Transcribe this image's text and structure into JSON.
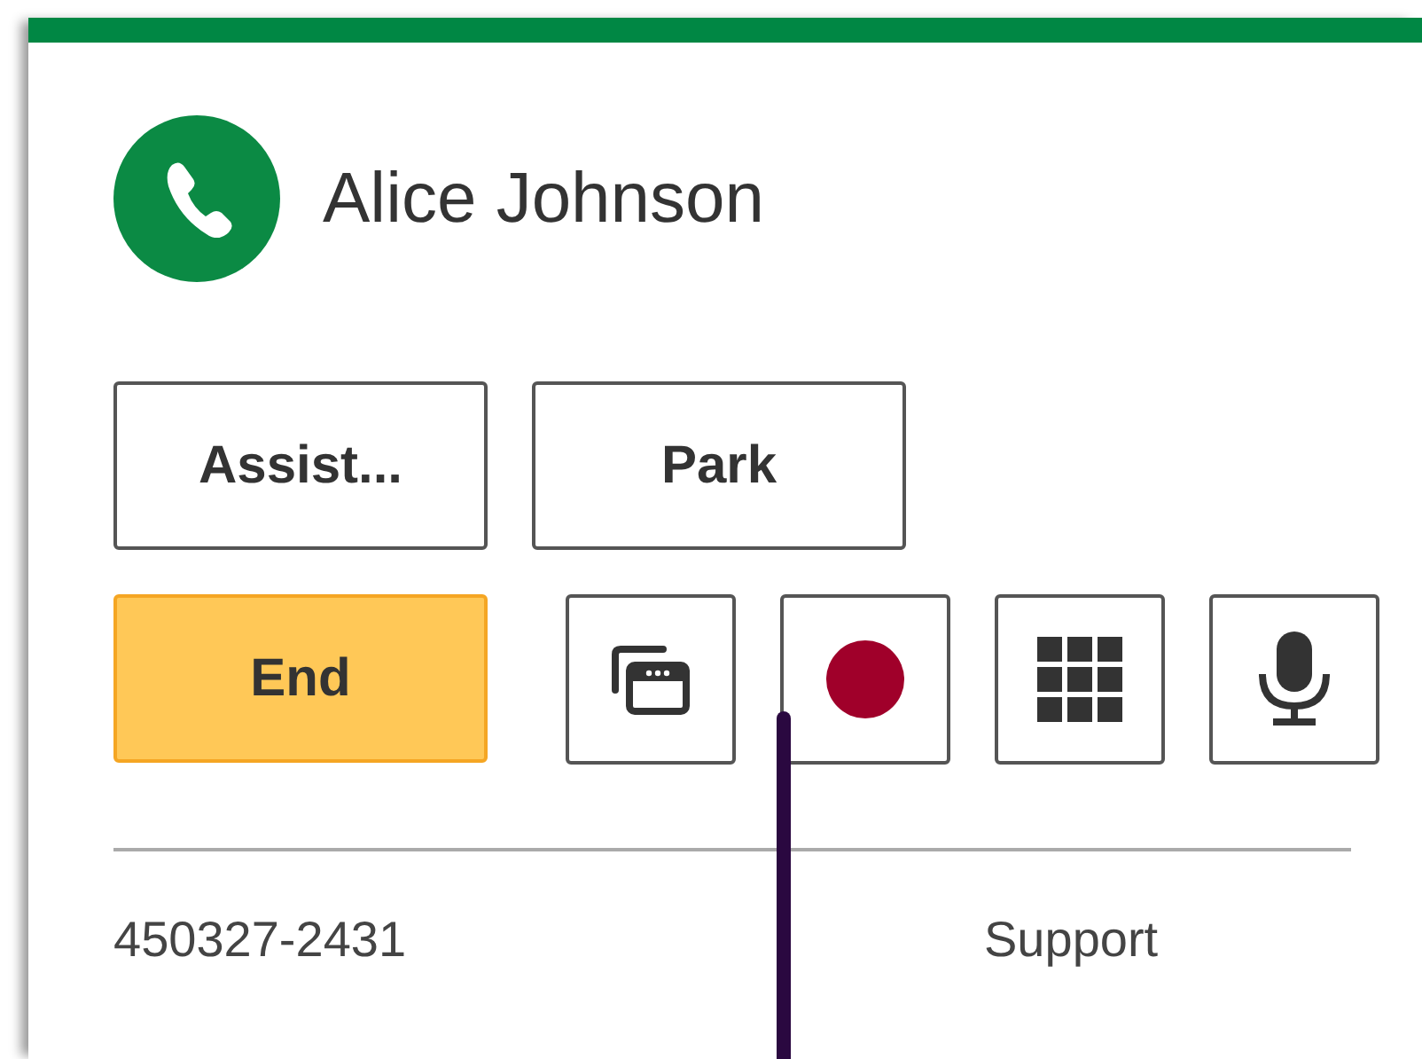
{
  "caller": {
    "name": "Alice Johnson"
  },
  "actions": [
    [
      {
        "kind": "text",
        "label": "Assist..."
      },
      {
        "kind": "text",
        "label": "Park"
      }
    ],
    [
      {
        "kind": "end",
        "label": "End"
      },
      {
        "kind": "windows"
      },
      {
        "kind": "record"
      },
      {
        "kind": "keypad"
      },
      {
        "kind": "mic"
      }
    ]
  ],
  "footer": {
    "number": "450327-2431",
    "queue": "Support"
  }
}
